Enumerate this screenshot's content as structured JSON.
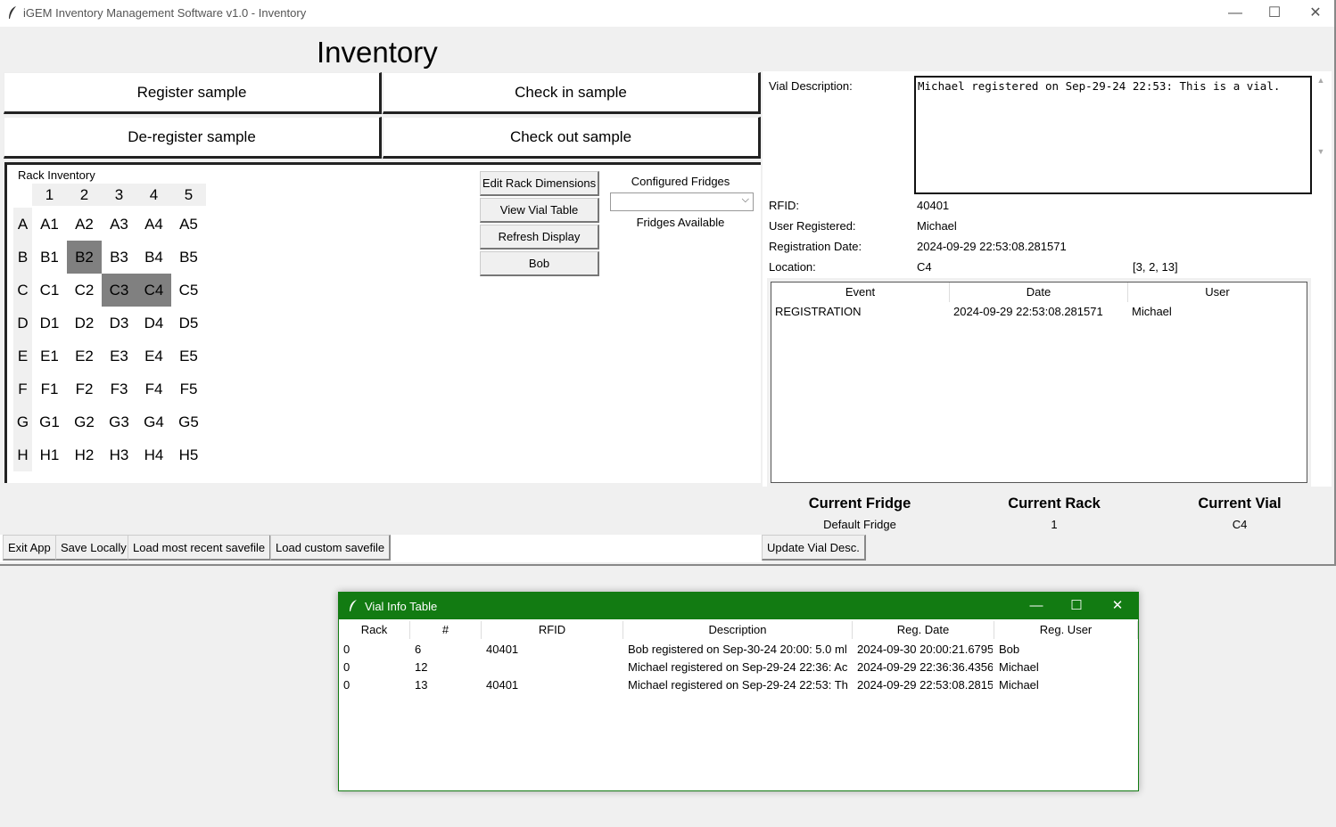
{
  "window": {
    "title": "iGEM Inventory Management Software v1.0 - Inventory"
  },
  "heading": "Inventory",
  "buttons": {
    "register": "Register sample",
    "checkin": "Check in sample",
    "deregister": "De-register sample",
    "checkout": "Check out sample"
  },
  "rack": {
    "title": "Rack Inventory",
    "columns": [
      "1",
      "2",
      "3",
      "4",
      "5"
    ],
    "rows": [
      "A",
      "B",
      "C",
      "D",
      "E",
      "F",
      "G",
      "H"
    ],
    "cells": [
      [
        "A1",
        "A2",
        "A3",
        "A4",
        "A5"
      ],
      [
        "B1",
        "B2",
        "B3",
        "B4",
        "B5"
      ],
      [
        "C1",
        "C2",
        "C3",
        "C4",
        "C5"
      ],
      [
        "D1",
        "D2",
        "D3",
        "D4",
        "D5"
      ],
      [
        "E1",
        "E2",
        "E3",
        "E4",
        "E5"
      ],
      [
        "F1",
        "F2",
        "F3",
        "F4",
        "F5"
      ],
      [
        "G1",
        "G2",
        "G3",
        "G4",
        "G5"
      ],
      [
        "H1",
        "H2",
        "H3",
        "H4",
        "H5"
      ]
    ],
    "occupied": [
      "B2",
      "C3",
      "C4"
    ],
    "side_buttons": [
      "Edit Rack Dimensions",
      "View Vial Table",
      "Refresh Display",
      "Bob"
    ],
    "configured_fridges_label": "Configured Fridges",
    "fridge_select_value": "",
    "fridges_available_label": "Fridges Available"
  },
  "details": {
    "desc_label": "Vial Description:",
    "desc_text": "Michael registered on Sep-29-24 22:53: This is a vial.",
    "rfid_label": "RFID:",
    "rfid_value": "40401",
    "user_label": "User Registered:",
    "user_value": "Michael",
    "date_label": "Registration Date:",
    "date_value": "2024-09-29 22:53:08.281571",
    "location_label": "Location:",
    "location_value": "C4",
    "location_coords": "[3, 2, 13]"
  },
  "events": {
    "headers": [
      "Event",
      "Date",
      "User"
    ],
    "rows": [
      [
        "REGISTRATION",
        "2024-09-29 22:53:08.281571",
        "Michael"
      ]
    ]
  },
  "current": {
    "fridge_label": "Current Fridge",
    "fridge_value": "Default Fridge",
    "rack_label": "Current Rack",
    "rack_value": "1",
    "vial_label": "Current Vial",
    "vial_value": "C4"
  },
  "bottom": {
    "exit": "Exit App",
    "save": "Save Locally",
    "load_recent": "Load most recent savefile",
    "load_custom": "Load custom savefile",
    "update_desc": "Update Vial Desc."
  },
  "vial_table": {
    "title": "Vial Info Table",
    "headers": [
      "Rack",
      "#",
      "RFID",
      "Description",
      "Reg. Date",
      "Reg. User"
    ],
    "rows": [
      [
        "0",
        "6",
        "40401",
        "Bob registered on Sep-30-24 20:00: 5.0 ml",
        "2024-09-30 20:00:21.6795(",
        "Bob"
      ],
      [
        "0",
        "12",
        "",
        "Michael registered on Sep-29-24 22:36: Ac",
        "2024-09-29 22:36:36.4356",
        "Michael"
      ],
      [
        "0",
        "13",
        "40401",
        "Michael registered on Sep-29-24 22:53: Th",
        "2024-09-29 22:53:08.2815",
        "Michael"
      ]
    ]
  }
}
